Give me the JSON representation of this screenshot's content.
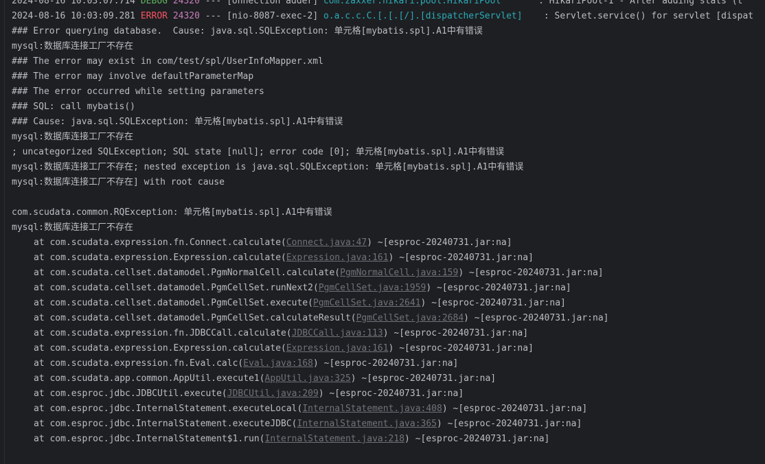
{
  "log_lines": [
    {
      "date": "2024-08-16 10:03:07.714",
      "level": "DEBUG",
      "pid": "24320",
      "sep": "---",
      "thread": "[onnection adder]",
      "logger": "com.zaxxer.hikari.pool.HikariPool",
      "message": ": HikariPool-1 - After adding stats (t"
    },
    {
      "date": "2024-08-16 10:03:09.281",
      "level": "ERROR",
      "pid": "24320",
      "sep": "---",
      "thread": "[nio-8087-exec-2]",
      "logger": "o.a.c.c.C.[.[.[/].[dispatcherServlet]",
      "message": ": Servlet.service() for servlet [dispat"
    }
  ],
  "plain_lines": [
    "### Error querying database.  Cause: java.sql.SQLException: 单元格[mybatis.spl].A1中有错误",
    "mysql:数据库连接工厂不存在",
    "### The error may exist in com/test/spl/UserInfoMapper.xml",
    "### The error may involve defaultParameterMap",
    "### The error occurred while setting parameters",
    "### SQL: call mybatis()",
    "### Cause: java.sql.SQLException: 单元格[mybatis.spl].A1中有错误",
    "mysql:数据库连接工厂不存在",
    "; uncategorized SQLException; SQL state [null]; error code [0]; 单元格[mybatis.spl].A1中有错误",
    "mysql:数据库连接工厂不存在; nested exception is java.sql.SQLException: 单元格[mybatis.spl].A1中有错误",
    "mysql:数据库连接工厂不存在] with root cause"
  ],
  "exception_lines": [
    "com.scudata.common.RQException: 单元格[mybatis.spl].A1中有错误",
    "mysql:数据库连接工厂不存在"
  ],
  "stack_trace": [
    {
      "prefix": "at com.scudata.expression.fn.Connect.calculate(",
      "link": "Connect.java:47",
      "suffix": ") ~[esproc-20240731.jar:na]"
    },
    {
      "prefix": "at com.scudata.expression.Expression.calculate(",
      "link": "Expression.java:161",
      "suffix": ") ~[esproc-20240731.jar:na]"
    },
    {
      "prefix": "at com.scudata.cellset.datamodel.PgmNormalCell.calculate(",
      "link": "PgmNormalCell.java:159",
      "suffix": ") ~[esproc-20240731.jar:na]"
    },
    {
      "prefix": "at com.scudata.cellset.datamodel.PgmCellSet.runNext2(",
      "link": "PgmCellSet.java:1959",
      "suffix": ") ~[esproc-20240731.jar:na]"
    },
    {
      "prefix": "at com.scudata.cellset.datamodel.PgmCellSet.execute(",
      "link": "PgmCellSet.java:2641",
      "suffix": ") ~[esproc-20240731.jar:na]"
    },
    {
      "prefix": "at com.scudata.cellset.datamodel.PgmCellSet.calculateResult(",
      "link": "PgmCellSet.java:2684",
      "suffix": ") ~[esproc-20240731.jar:na]"
    },
    {
      "prefix": "at com.scudata.expression.fn.JDBCCall.calculate(",
      "link": "JDBCCall.java:113",
      "suffix": ") ~[esproc-20240731.jar:na]"
    },
    {
      "prefix": "at com.scudata.expression.Expression.calculate(",
      "link": "Expression.java:161",
      "suffix": ") ~[esproc-20240731.jar:na]"
    },
    {
      "prefix": "at com.scudata.expression.fn.Eval.calc(",
      "link": "Eval.java:168",
      "suffix": ") ~[esproc-20240731.jar:na]"
    },
    {
      "prefix": "at com.scudata.app.common.AppUtil.execute1(",
      "link": "AppUtil.java:325",
      "suffix": ") ~[esproc-20240731.jar:na]"
    },
    {
      "prefix": "at com.esproc.jdbc.JDBCUtil.execute(",
      "link": "JDBCUtil.java:209",
      "suffix": ") ~[esproc-20240731.jar:na]"
    },
    {
      "prefix": "at com.esproc.jdbc.InternalStatement.executeLocal(",
      "link": "InternalStatement.java:408",
      "suffix": ") ~[esproc-20240731.jar:na]"
    },
    {
      "prefix": "at com.esproc.jdbc.InternalStatement.executeJDBC(",
      "link": "InternalStatement.java:365",
      "suffix": ") ~[esproc-20240731.jar:na]"
    },
    {
      "prefix": "at com.esproc.jdbc.InternalStatement$1.run(",
      "link": "InternalStatement.java:218",
      "suffix": ") ~[esproc-20240731.jar:na]"
    }
  ],
  "colors": {
    "background": "#1e1f22",
    "text": "#bcbec4",
    "debug": "#5fb65f",
    "error": "#f75464",
    "pid": "#c77dbb",
    "logger": "#2aacb8",
    "link": "#6f737a"
  }
}
